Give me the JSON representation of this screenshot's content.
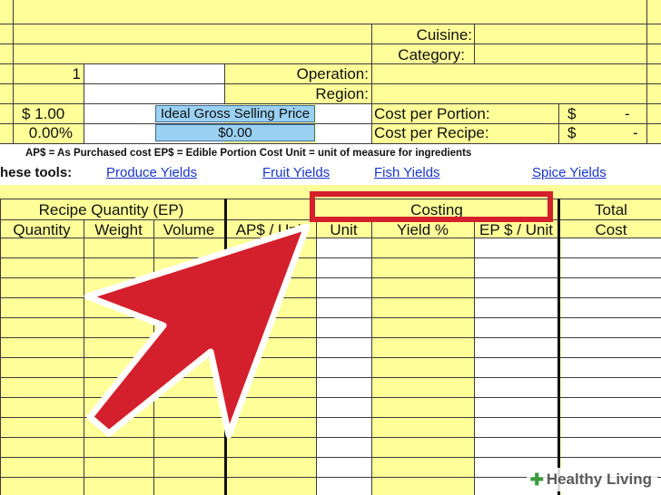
{
  "header": {
    "cuisine_label": "Cuisine:",
    "category_label": "Category:",
    "operation_label": "Operation:",
    "region_label": "Region:",
    "servings_value": "1",
    "price_value": "$  1.00",
    "percent_value": "0.00%",
    "ideal_price_label": "Ideal Gross Selling Price",
    "ideal_price_value": "$0.00",
    "cost_per_portion_label": "Cost per Portion:",
    "cost_per_recipe_label": "Cost per Recipe:",
    "currency_symbol": "$",
    "dash_value": "-"
  },
  "legend": {
    "text": "AP$ = As Purchased cost   EP$ = Edible Portion Cost   Unit = unit of measure for ingredients"
  },
  "tools": {
    "label": "hese tools:",
    "links": [
      "Produce Yields",
      "Fruit Yields",
      "Fish Yields",
      "Spice Yields"
    ]
  },
  "table": {
    "group_headers": {
      "recipe_quantity": "Recipe Quantity (EP)",
      "costing": "Costing",
      "total": "Total"
    },
    "columns": [
      "Quantity",
      "Weight",
      "Volume",
      "AP$ / Unit",
      "Unit",
      "Yield %",
      "EP $ / Unit",
      "Cost"
    ]
  },
  "overlay": {
    "highlight_color": "#d4202c",
    "arrow_color": "#d4202c"
  },
  "watermark": {
    "icon": "plus-leaf-icon",
    "text": "Healthy Living"
  }
}
